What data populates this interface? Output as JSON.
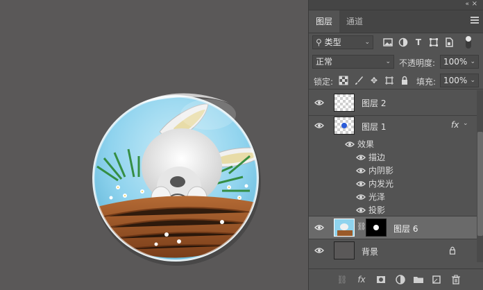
{
  "panel": {
    "tabs": [
      "图层",
      "通道"
    ],
    "filter": {
      "value": "类型"
    },
    "blend_mode": "正常",
    "opacity_label": "不透明度:",
    "opacity_value": "100%",
    "lock_label": "锁定:",
    "fill_label": "填充:",
    "fill_value": "100%"
  },
  "layers": [
    {
      "name": "图层 2"
    },
    {
      "name": "图层 1",
      "fx": "fx"
    },
    {
      "name": "图层 6"
    },
    {
      "name": "背景"
    }
  ],
  "effects": {
    "header": "效果",
    "items": [
      "描边",
      "内阴影",
      "内发光",
      "光泽",
      "投影"
    ]
  },
  "colors": {
    "canvas_bg": "#5a5858",
    "panel_bg": "#535353",
    "selected_row": "#6a6a6a",
    "sphere_sky": "#8fd3ee"
  },
  "icons": {
    "collapse": "«",
    "close": "×",
    "fx": "fx"
  }
}
